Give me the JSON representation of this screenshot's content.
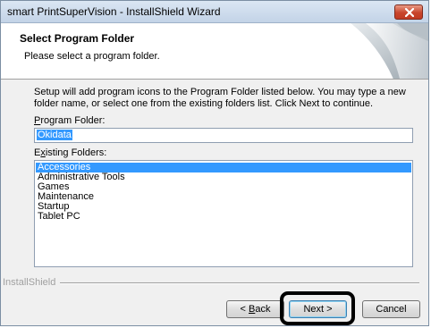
{
  "window": {
    "title": "smart PrintSuperVision - InstallShield Wizard"
  },
  "header": {
    "title": "Select Program Folder",
    "subtitle": "Please select a program folder."
  },
  "main": {
    "description": "Setup will add program icons to the Program Folder listed below.  You may type a new folder name, or select one from the existing folders list.  Click Next to continue.",
    "program_folder_label": "Program Folder:",
    "program_folder_value": "Okidata",
    "existing_folders_label": "Existing Folders:",
    "existing_folders": [
      {
        "label": "Accessories",
        "selected": true
      },
      {
        "label": "Administrative Tools",
        "selected": false
      },
      {
        "label": "Games",
        "selected": false
      },
      {
        "label": "Maintenance",
        "selected": false
      },
      {
        "label": "Startup",
        "selected": false
      },
      {
        "label": "Tablet PC",
        "selected": false
      }
    ]
  },
  "footer": {
    "brand": "InstallShield",
    "back_label": "< Back",
    "next_label": "Next >",
    "cancel_label": "Cancel"
  },
  "colors": {
    "selection": "#3399ff",
    "close_button": "#c8452c",
    "callout": "#000000"
  }
}
